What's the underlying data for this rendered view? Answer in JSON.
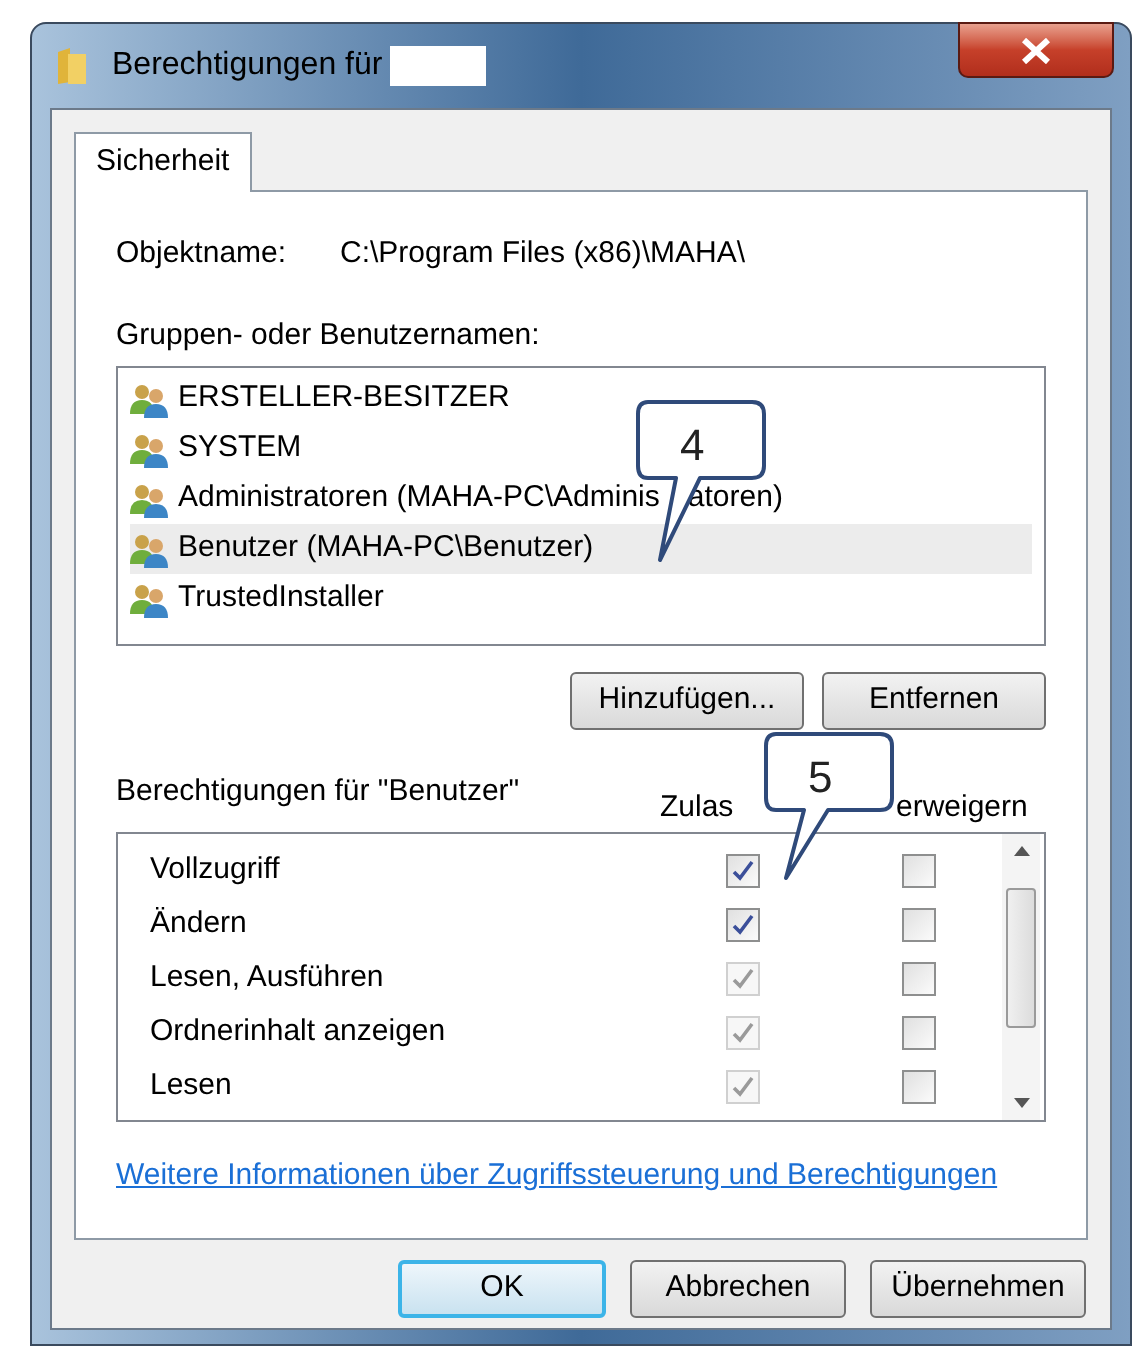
{
  "window": {
    "title": "Berechtigungen für"
  },
  "tabs": [
    {
      "label": "Sicherheit",
      "selected": true
    }
  ],
  "object": {
    "label": "Objektname:",
    "value": "C:\\Program Files (x86)\\MAHA\\"
  },
  "groups": {
    "label": "Gruppen- oder Benutzernamen:",
    "items": [
      {
        "name": "ERSTELLER-BESITZER",
        "selected": false
      },
      {
        "name": "SYSTEM",
        "selected": false
      },
      {
        "name": "Administratoren (MAHA-PC\\Adminis",
        "name_end": "atoren)",
        "selected": false
      },
      {
        "name": "Benutzer (MAHA-PC\\Benutzer)",
        "selected": true
      },
      {
        "name": "TrustedInstaller",
        "selected": false
      }
    ],
    "buttons": [
      "Hinzufügen...",
      "Entfernen"
    ]
  },
  "permissions": {
    "label": "Berechtigungen für \"Benutzer\"",
    "columns": [
      "Zulas",
      "erweigern"
    ],
    "rows": [
      {
        "name": "Vollzugriff",
        "allow": true,
        "allow_disabled": false,
        "deny": false
      },
      {
        "name": "Ändern",
        "allow": true,
        "allow_disabled": false,
        "deny": false
      },
      {
        "name": "Lesen, Ausführen",
        "allow": true,
        "allow_disabled": true,
        "deny": false
      },
      {
        "name": "Ordnerinhalt anzeigen",
        "allow": true,
        "allow_disabled": true,
        "deny": false
      },
      {
        "name": "Lesen",
        "allow": true,
        "allow_disabled": true,
        "deny": false
      }
    ]
  },
  "link": "Weitere Informationen über Zugriffssteuerung und Berechtigungen",
  "footer_buttons": [
    {
      "label": "OK",
      "default": true
    },
    {
      "label": "Abbrechen",
      "default": false
    },
    {
      "label": "Übernehmen",
      "default": false
    }
  ],
  "callouts": [
    {
      "label": "4"
    },
    {
      "label": "5"
    }
  ]
}
